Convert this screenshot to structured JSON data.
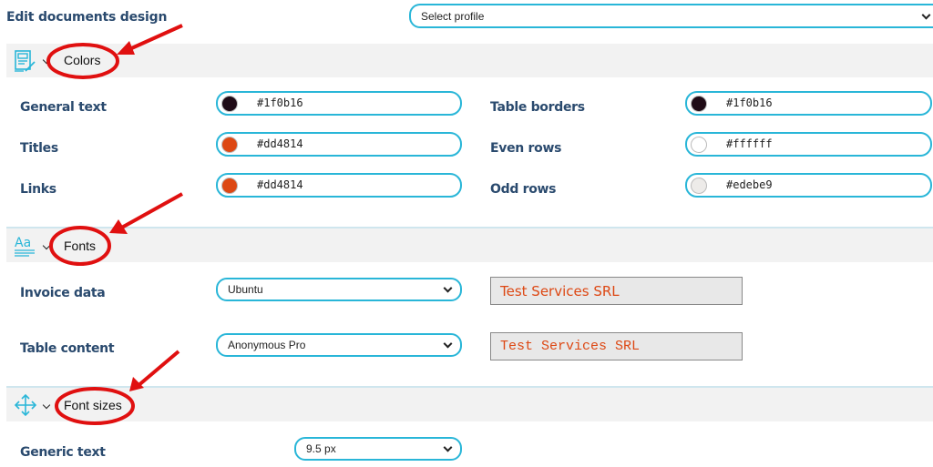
{
  "page": {
    "title": "Edit documents design"
  },
  "profile_select": {
    "value": "Select profile"
  },
  "sections": {
    "colors": {
      "title": "Colors",
      "fields": [
        {
          "label": "General text",
          "value": "#1f0b16",
          "swatch": "#1f0b16"
        },
        {
          "label": "Titles",
          "value": "#dd4814",
          "swatch": "#dd4814"
        },
        {
          "label": "Links",
          "value": "#dd4814",
          "swatch": "#dd4814"
        },
        {
          "label": "Table borders",
          "value": "#1f0b16",
          "swatch": "#1f0b16"
        },
        {
          "label": "Even rows",
          "value": "#ffffff",
          "swatch": "#ffffff"
        },
        {
          "label": "Odd rows",
          "value": "#edebe9",
          "swatch": "#edebe9"
        }
      ]
    },
    "fonts": {
      "title": "Fonts",
      "invoice_data": {
        "label": "Invoice data",
        "value": "Ubuntu",
        "preview": "Test Services SRL"
      },
      "table_content": {
        "label": "Table content",
        "value": "Anonymous Pro",
        "preview": "Test Services SRL"
      }
    },
    "font_sizes": {
      "title": "Font sizes",
      "generic_text": {
        "label": "Generic text",
        "value": "9.5 px"
      }
    }
  },
  "colors": {
    "accent": "#29b6d8",
    "annotation": "#e01010",
    "preview_text": "#dd4814"
  }
}
